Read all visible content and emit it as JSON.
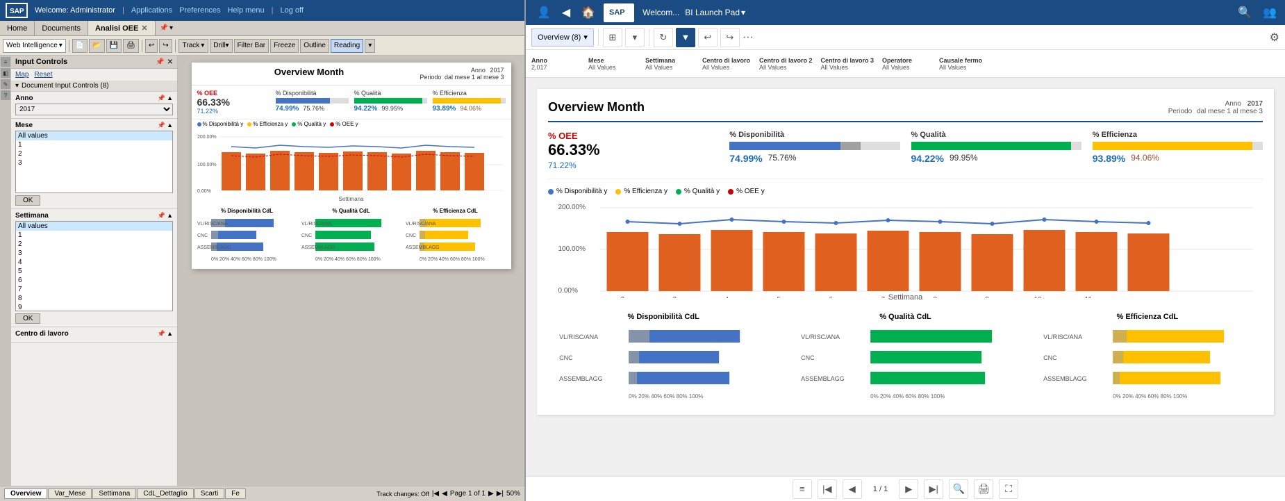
{
  "left": {
    "topbar": {
      "welcome": "Welcome: Administrator",
      "applications": "Applications",
      "preferences": "Preferences",
      "help_menu": "Help menu",
      "logoff": "Log off"
    },
    "nav_tabs": [
      {
        "label": "Home",
        "active": false
      },
      {
        "label": "Documents",
        "active": false
      },
      {
        "label": "Analisi OEE",
        "active": true
      }
    ],
    "toolbar": {
      "web_intelligence": "Web Intelligence",
      "track": "Track",
      "drill": "Drill",
      "filter_bar": "Filter Bar",
      "freeze": "Freeze",
      "outline": "Outline",
      "reading": "Reading"
    },
    "input_controls": {
      "title": "Input Controls",
      "map": "Map",
      "reset": "Reset",
      "section_title": "Document Input Controls (8)",
      "anno_label": "Anno",
      "anno_value": "2017",
      "mese_label": "Mese",
      "mese_values": [
        "All values",
        "1",
        "2",
        "3"
      ],
      "ok1": "OK",
      "settimana_label": "Settimana",
      "settimana_values": [
        "All values",
        "1",
        "2",
        "3",
        "4",
        "5",
        "6",
        "7",
        "8",
        "9"
      ],
      "ok2": "OK",
      "centro_label": "Centro di lavoro"
    },
    "report": {
      "title": "Overview Month",
      "anno_label": "Anno",
      "anno_value": "2017",
      "periodo_label": "Periodo",
      "periodo_value": "dal mese 1 al mese 3",
      "oee_label": "% OEE",
      "oee_value": "66.33%",
      "oee_secondary": "71.22%",
      "disp_label": "% Disponibilità",
      "disp_primary": "74.99%",
      "disp_secondary": "75.76%",
      "qualita_label": "% Qualità",
      "qualita_primary": "94.22%",
      "qualita_secondary": "99.95%",
      "efficienza_label": "% Efficienza",
      "efficienza_primary": "93.89%",
      "efficienza_secondary": "94.06%"
    },
    "bottom_tabs": [
      "Overview",
      "Var_Mese",
      "Settimana",
      "CdL_Dettaglio",
      "Scarti",
      "Fe"
    ],
    "bottom_bar": {
      "track_changes": "Track changes: Off",
      "page": "Page 1 of 1",
      "zoom": "50%"
    }
  },
  "right": {
    "topbar": {
      "welcome": "Welcom...",
      "bi_launch_pad": "BI Launch Pad"
    },
    "toolbar": {
      "overview_tab": "Overview (8)"
    },
    "filter_bar": {
      "anno_label": "Anno",
      "anno_value": "2,017",
      "mese_label": "Mese",
      "mese_value": "All Values",
      "settimana_label": "Settimana",
      "settimana_value": "All Values",
      "centro_label": "Centro di lavoro",
      "centro_value": "All Values",
      "centro2_label": "Centro di lavoro 2",
      "centro2_value": "All Values",
      "centro3_label": "Centro di lavoro 3",
      "centro3_value": "All Values",
      "operatore_label": "Operatore",
      "operatore_value": "All Values",
      "causale_label": "Causale fermo",
      "causale_value": "All Values"
    },
    "report": {
      "title": "Overview Month",
      "anno_label": "Anno",
      "anno_value": "2017",
      "periodo_label": "Periodo",
      "periodo_value": "dal mese 1 al mese 3",
      "oee_label": "% OEE",
      "oee_value": "66.33%",
      "oee_secondary": "71.22%",
      "disp_label": "% Disponibilità",
      "disp_primary": "74.99%",
      "disp_secondary": "75.76%",
      "qualita_label": "% Qualità",
      "qualita_primary": "94.22%",
      "qualita_secondary": "99.95%",
      "efficienza_label": "% Efficienza",
      "efficienza_primary": "93.89%",
      "efficienza_secondary": "94.06%",
      "settimana_axis": "Settimana",
      "disp_cdl": "% Disponibilità CdL",
      "qualita_cdl": "% Qualità CdL",
      "efficienza_cdl": "% Efficienza CdL"
    },
    "bottom_bar": {
      "page": "1 / 1"
    },
    "legend": {
      "disp": "% Disponibilità y",
      "eff": "% Efficienza y",
      "qualita": "% Qualità y",
      "oee": "% OEE y"
    }
  }
}
